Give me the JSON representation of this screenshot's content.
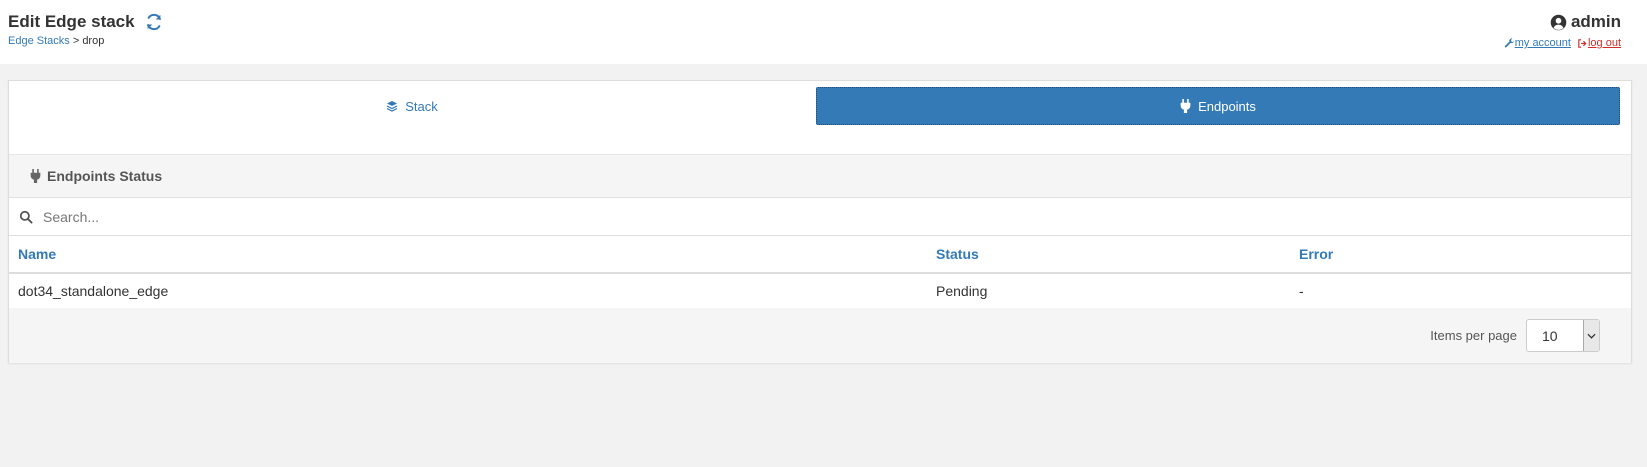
{
  "header": {
    "title": "Edit Edge stack",
    "breadcrumb": {
      "parent": "Edge Stacks",
      "separator": " > ",
      "current": "drop"
    },
    "user": {
      "name": "admin",
      "my_account": "my account",
      "log_out": "log out"
    }
  },
  "tabs": [
    {
      "label": "Stack",
      "icon": "layers-icon",
      "active": false
    },
    {
      "label": "Endpoints",
      "icon": "plug-icon",
      "active": true
    }
  ],
  "endpoints_status": {
    "title": "Endpoints Status",
    "search_placeholder": "Search...",
    "columns": [
      "Name",
      "Status",
      "Error"
    ],
    "rows": [
      {
        "name": "dot34_standalone_edge",
        "status": "Pending",
        "error": "-"
      }
    ],
    "items_per_page_label": "Items per page",
    "items_per_page_value": "10"
  },
  "colors": {
    "accent": "#337ab7",
    "danger": "#c9302c",
    "page_bg": "#f2f2f2"
  }
}
